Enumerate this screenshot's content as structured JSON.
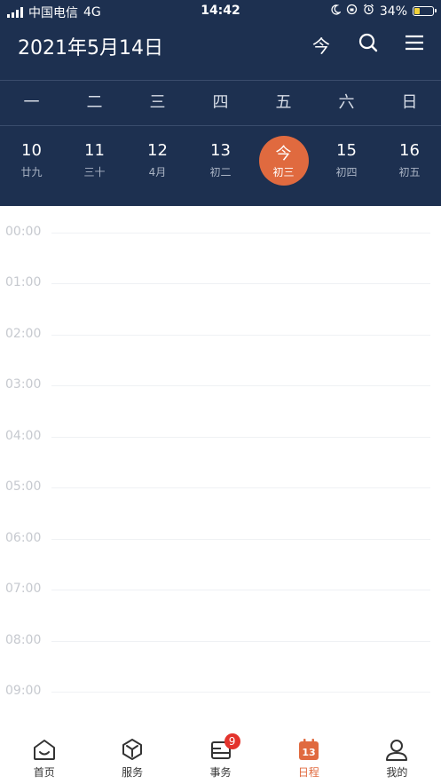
{
  "status_bar": {
    "carrier": "中国电信",
    "network": "4G",
    "time": "14:42",
    "battery": "34%",
    "battery_level": 0.34
  },
  "header": {
    "title": "2021年5月14日",
    "today_button": "今"
  },
  "weekdays": [
    "一",
    "二",
    "三",
    "四",
    "五",
    "六",
    "日"
  ],
  "days": [
    {
      "num": "10",
      "lunar": "廿九"
    },
    {
      "num": "11",
      "lunar": "三十"
    },
    {
      "num": "12",
      "lunar": "4月"
    },
    {
      "num": "13",
      "lunar": "初二"
    },
    {
      "num": "今",
      "lunar": "初三",
      "today": true
    },
    {
      "num": "15",
      "lunar": "初四"
    },
    {
      "num": "16",
      "lunar": "初五"
    }
  ],
  "hours": [
    "00:00",
    "01:00",
    "02:00",
    "03:00",
    "04:00",
    "05:00",
    "06:00",
    "07:00",
    "08:00",
    "09:00"
  ],
  "tabs": [
    {
      "label": "首页",
      "icon": "home-icon"
    },
    {
      "label": "服务",
      "icon": "cube-icon"
    },
    {
      "label": "事务",
      "icon": "inbox-icon",
      "badge": "9"
    },
    {
      "label": "日程",
      "icon": "calendar-icon",
      "active": true,
      "calendar_day": "13"
    },
    {
      "label": "我的",
      "icon": "profile-icon"
    }
  ],
  "colors": {
    "header_bg": "#1d3050",
    "accent": "#e06a3f",
    "badge": "#e3332c"
  }
}
